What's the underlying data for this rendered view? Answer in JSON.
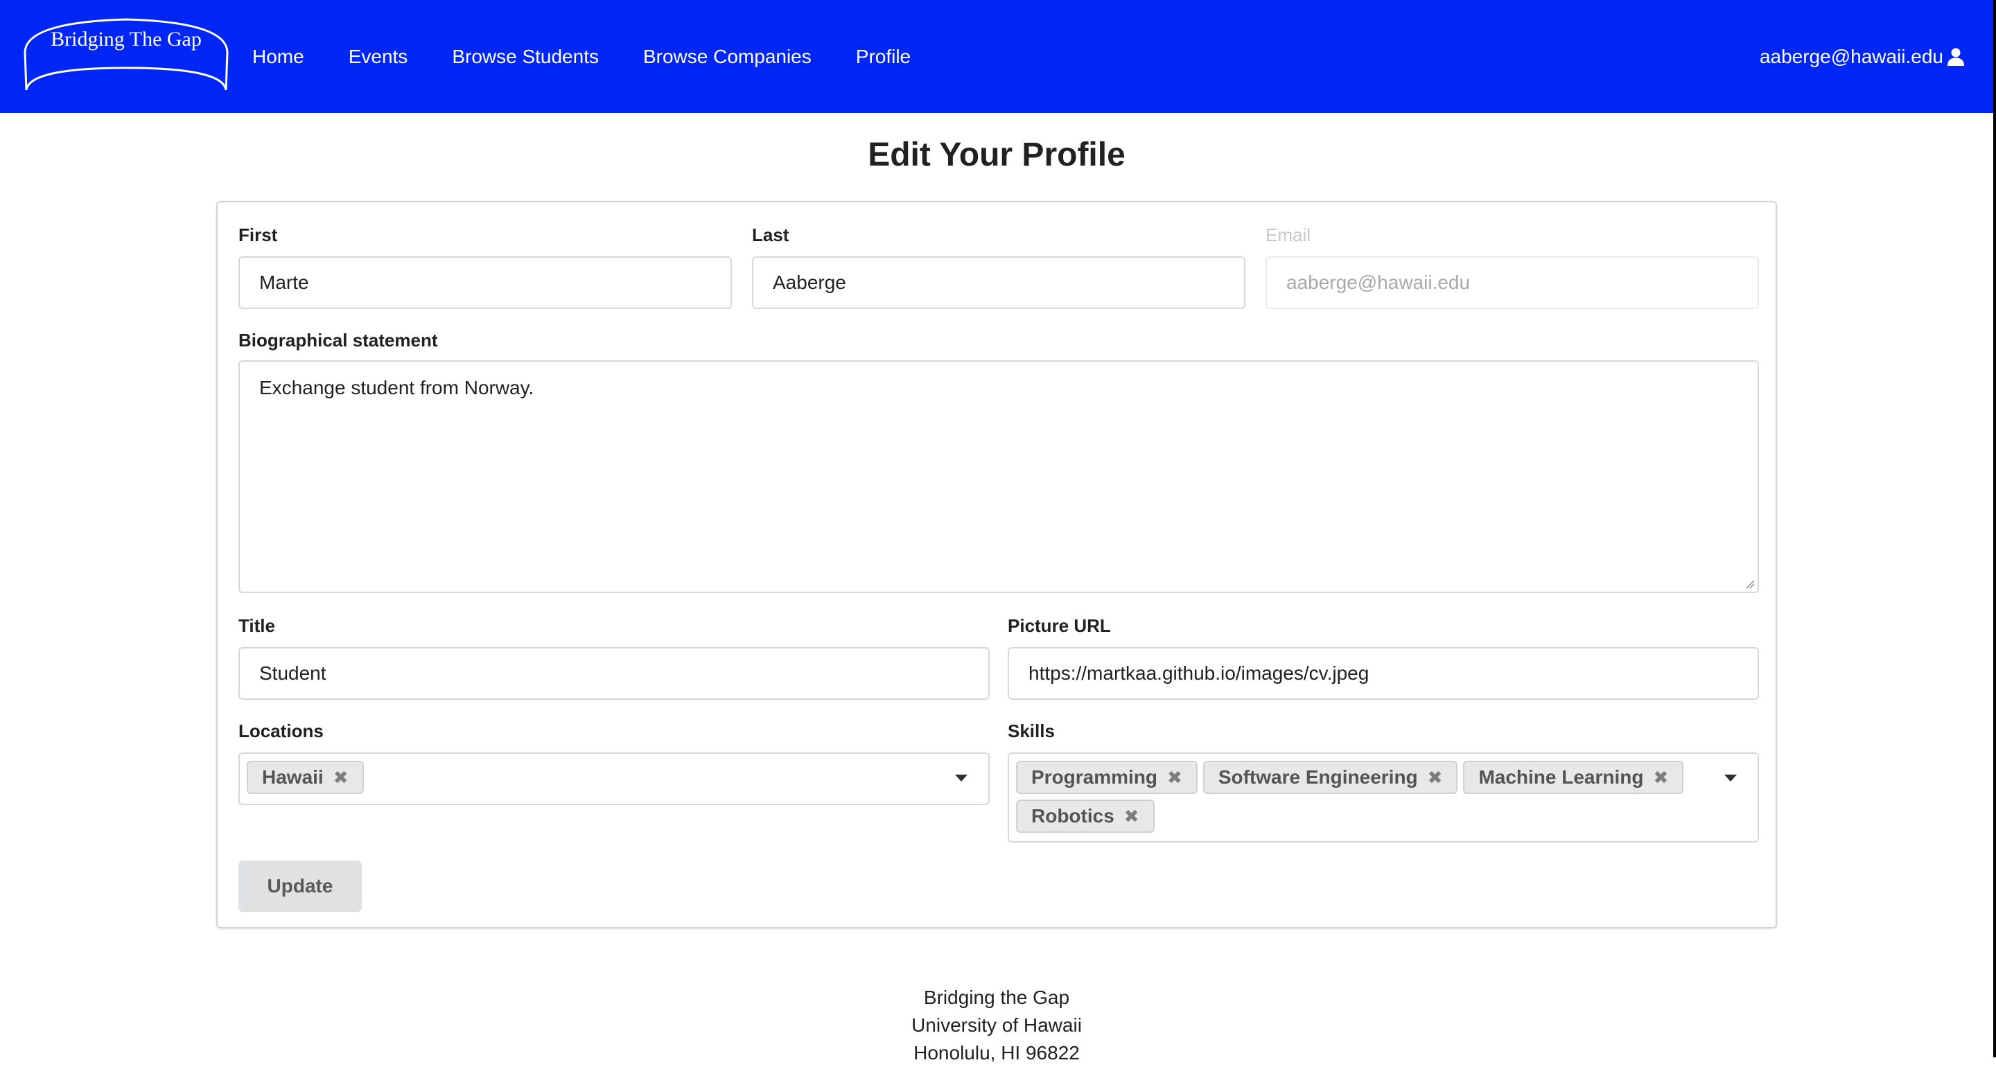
{
  "navbar": {
    "logo_text": "Bridging The Gap",
    "items": [
      {
        "label": "Home"
      },
      {
        "label": "Events"
      },
      {
        "label": "Browse Students"
      },
      {
        "label": "Browse Companies"
      },
      {
        "label": "Profile"
      }
    ],
    "user_email": "aaberge@hawaii.edu",
    "user_icon": "user-icon",
    "background_color": "#0026f6"
  },
  "page": {
    "title": "Edit Your Profile"
  },
  "form": {
    "first": {
      "label": "First",
      "value": "Marte"
    },
    "last": {
      "label": "Last",
      "value": "Aaberge"
    },
    "email": {
      "label": "Email",
      "value": "aaberge@hawaii.edu",
      "disabled": true
    },
    "bio": {
      "label": "Biographical statement",
      "value": "Exchange student from Norway."
    },
    "title": {
      "label": "Title",
      "value": "Student"
    },
    "picture": {
      "label": "Picture URL",
      "value": "https://martkaa.github.io/images/cv.jpeg"
    },
    "locations": {
      "label": "Locations",
      "selected": [
        "Hawaii"
      ]
    },
    "skills": {
      "label": "Skills",
      "selected": [
        "Programming",
        "Software Engineering",
        "Machine Learning",
        "Robotics"
      ]
    },
    "update_label": "Update"
  },
  "footer": {
    "line1": "Bridging the Gap",
    "line2": "University of Hawaii",
    "line3": "Honolulu, HI 96822"
  }
}
